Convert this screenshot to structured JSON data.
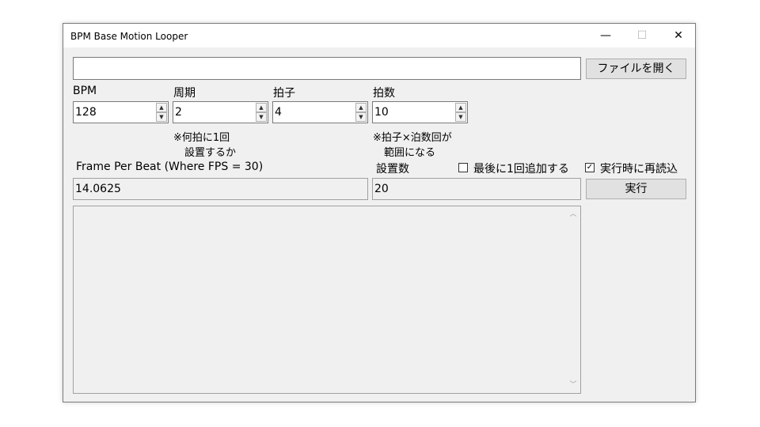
{
  "window": {
    "title": "BPM Base Motion Looper",
    "minimize_glyph": "—",
    "maximize_glyph": "☐",
    "close_glyph": "✕"
  },
  "file": {
    "path_value": "",
    "open_button_label": "ファイルを開く"
  },
  "fields": {
    "bpm": {
      "label": "BPM",
      "value": "128"
    },
    "period": {
      "label": "周期",
      "value": "2",
      "note_line1": "※何拍に1回",
      "note_line2": "設置するか"
    },
    "time_signature": {
      "label": "拍子",
      "value": "4"
    },
    "beat_count": {
      "label": "拍数",
      "value": "10",
      "note_line1": "※拍子×泊数回が",
      "note_line2": "範囲になる"
    }
  },
  "frame_per_beat": {
    "label": "Frame Per Beat (Where FPS = 30)",
    "value": "14.0625"
  },
  "placement_count": {
    "label": "設置数",
    "value": "20"
  },
  "options": {
    "add_once_at_end": {
      "label": "最後に1回追加する",
      "checked": false,
      "glyph": ""
    },
    "reload_on_run": {
      "label": "実行時に再読込",
      "checked": true,
      "glyph": "✓"
    }
  },
  "run_button_label": "実行",
  "output": {
    "text": "",
    "scroll_up_glyph": "︿",
    "scroll_down_glyph": "﹀"
  },
  "icons": {
    "spin_up": "▲",
    "spin_down": "▼"
  }
}
